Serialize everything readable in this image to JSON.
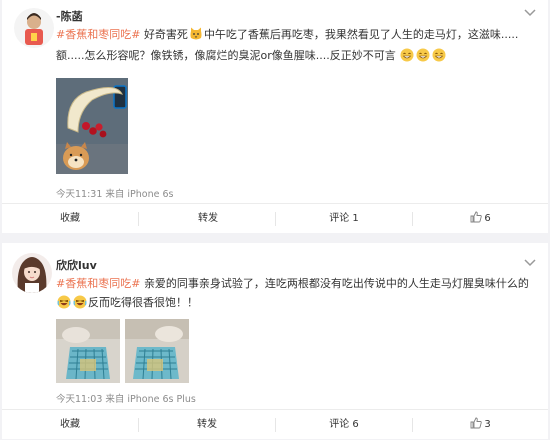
{
  "posts": [
    {
      "username": "-陈菡",
      "line1_tag": "#香蕉和枣同吃#",
      "line1_a": "好奇害死",
      "line1_b": "中午吃了香蕉后再吃枣，我果然看见了人生的走马灯，这滋味.....",
      "line2": "额.....怎么形容呢？像铁锈，像腐烂的臭泥or像鱼腥味....反正妙不可言",
      "meta": "今天11:31 来自 iPhone 6s",
      "actions": {
        "favorite": "收藏",
        "repost": "转发",
        "comment": "评论 1",
        "likes": "6"
      }
    },
    {
      "username": "欣欣luv",
      "line1_tag": "#香蕉和枣同吃#",
      "line1_a": "亲爱的同事亲身试验了，连吃两根都没有吃出传说中的人生走马灯腥臭味什么的",
      "line2": "反而吃得很香很饱！！",
      "meta": "今天11:03 来自 iPhone 6s Plus",
      "actions": {
        "favorite": "收藏",
        "repost": "转发",
        "comment": "评论 6",
        "likes": "3"
      }
    }
  ],
  "colors": {
    "tag": "#eb7350",
    "meta": "#8c8c8c",
    "background": "#f2f2f5"
  },
  "icons": [
    "chevron-down-icon",
    "cat-emoji-icon",
    "grin-emoji-icon",
    "laugh-cry-emoji-icon",
    "repost-icon",
    "comment-icon",
    "like-icon"
  ]
}
